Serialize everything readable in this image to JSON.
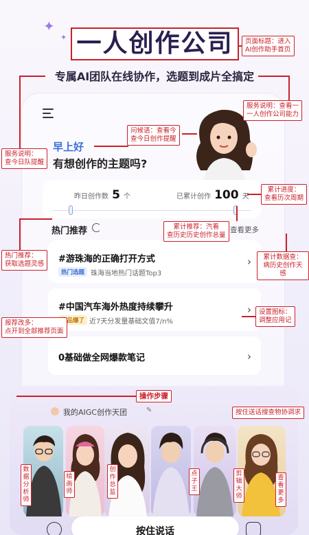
{
  "header": {
    "title": "一人创作公司",
    "subtitle": "专属AI团队在线协作，选题到成片全搞定"
  },
  "app": {
    "greeting": "早上好",
    "question": "有想创作的主题吗?",
    "stats": {
      "yesterday_label": "昨日创作数",
      "yesterday_value": "5",
      "yesterday_unit": "个",
      "total_label": "已累计创作",
      "total_value": "100",
      "total_unit": "天"
    },
    "hot": {
      "title": "热门推荐",
      "see_more": "查看更多",
      "topics": [
        {
          "title": "#游珠海的正确打开方式",
          "tag": "热门选题",
          "sub": "珠海当地热门话题Top3"
        },
        {
          "title": "#中国汽车海外热度持续攀升",
          "tag": "作品爆了",
          "sub": "近7天分发量基础文值7/n%"
        },
        {
          "title": "0基础做全网爆款笔记",
          "tag": "",
          "sub": ""
        }
      ]
    },
    "team": {
      "header": "我的AIGC创作天团",
      "roles": [
        "数据分析师",
        "绘画师",
        "创作总监",
        "点子王",
        "剪辑大师",
        "查看更多"
      ]
    },
    "bottom": {
      "press_to_talk": "按住说话"
    }
  },
  "annotations": {
    "page_title": "页面标题：进入\nAI创作助手首页",
    "service_desc_right": "服务说明：查看一\n一人创作公司能力",
    "greeting_note": "问候语：查看今\n查今日创作提醒",
    "service_desc_left": "服务说明：\n查今日队提醒",
    "progress": "累计进度：\n查看历次周期",
    "accum_recommend": "累计推荐：汽看\n查历史历史创作总量",
    "hot_recommend": "热门推荐：\n获取选题灵感",
    "accum_data": "累计数据查：\n病历史创作天感",
    "report_entry": "报荐改多：\n点开到全部推荐页面",
    "settings_icon": "设置图标：\n调整应用记",
    "operation_steps": "操作步骤",
    "voice_hint": "按住送话搜查物协调求"
  },
  "colors": {
    "accent_red": "#c9202a",
    "title_purple": "#2b1f4f",
    "greeting_blue": "#3a6fd8"
  }
}
